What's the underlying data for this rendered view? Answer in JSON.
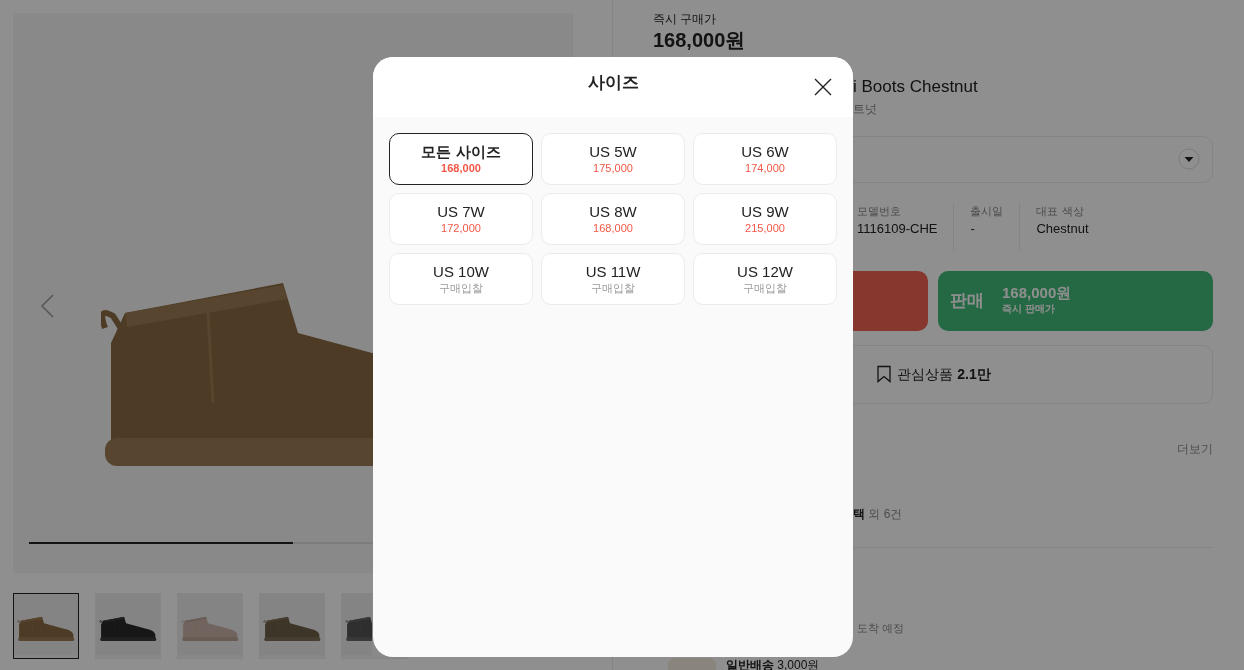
{
  "product": {
    "price_label": "즉시 구매가",
    "price": "168,000원",
    "title": "i Boots Chestnut",
    "subtitle": "트넛"
  },
  "gallery": {
    "level": 0.5,
    "thumbnails": [
      {
        "selected": true
      },
      {
        "selected": false
      },
      {
        "selected": false
      },
      {
        "selected": false
      },
      {
        "selected": false
      }
    ]
  },
  "details": [
    {
      "label": "모델번호",
      "value": "1116109-CHE"
    },
    {
      "label": "출시일",
      "value": "-"
    },
    {
      "label": "대표 색상",
      "value": "Chestnut"
    }
  ],
  "sell_button": {
    "label": "판매",
    "price": "168,000원",
    "caption": "즉시 판매가"
  },
  "wishlist_button": "관심상품 **2.1만**",
  "more_link": "더보기",
  "benefits": "**택** 외 6건",
  "arrival": "도착 예정",
  "shipping": "**일반배송** 3,000원",
  "size_modal": {
    "title": "사이즈",
    "sizes": [
      {
        "label": "모든 사이즈",
        "sub": "168,000",
        "kind": "price",
        "selected": true
      },
      {
        "label": "US 5W",
        "sub": "175,000",
        "kind": "price",
        "selected": false
      },
      {
        "label": "US 6W",
        "sub": "174,000",
        "kind": "price",
        "selected": false
      },
      {
        "label": "US 7W",
        "sub": "172,000",
        "kind": "price",
        "selected": false
      },
      {
        "label": "US 8W",
        "sub": "168,000",
        "kind": "price",
        "selected": false
      },
      {
        "label": "US 9W",
        "sub": "215,000",
        "kind": "price",
        "selected": false
      },
      {
        "label": "US 10W",
        "sub": "구매입찰",
        "kind": "bid",
        "selected": false
      },
      {
        "label": "US 11W",
        "sub": "구매입찰",
        "kind": "bid",
        "selected": false
      },
      {
        "label": "US 12W",
        "sub": "구매입찰",
        "kind": "bid",
        "selected": false
      }
    ]
  }
}
